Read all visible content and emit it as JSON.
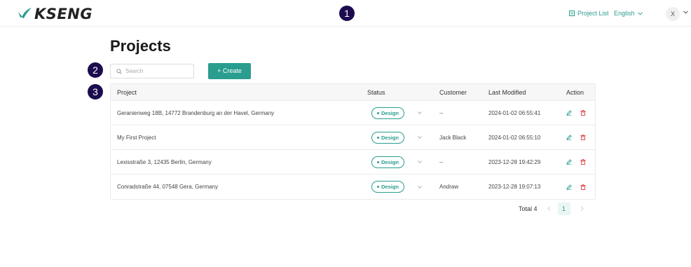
{
  "header": {
    "logo_text": "KSENG",
    "brand_color": "#2a9d8f",
    "logo_icon": "kseng-leaf-logo",
    "nav": {
      "project_list_label": "Project List",
      "project_list_icon": "list-icon"
    },
    "language": {
      "label": "English",
      "icon": "chevron-down-icon"
    },
    "user": {
      "avatar_text": "X",
      "icon": "chevron-down-icon"
    }
  },
  "markers": [
    "1",
    "2",
    "3"
  ],
  "page": {
    "title": "Projects",
    "search": {
      "placeholder": "Search",
      "value": "",
      "icon": "search-icon"
    },
    "create_button": "+ Create"
  },
  "table": {
    "columns": [
      "Project",
      "Status",
      "Customer",
      "Last Modified",
      "Action"
    ],
    "rows": [
      {
        "project": "Geranienweg 18B, 14772 Brandenburg an der Havel, Germany",
        "status": "Design",
        "customer": "--",
        "last_modified": "2024-01-02 06:55:41"
      },
      {
        "project": "My First Project",
        "status": "Design",
        "customer": "Jack Black",
        "last_modified": "2024-01-02 06:55:10"
      },
      {
        "project": "Lexisstraße 3, 12435 Berlin, Germany",
        "status": "Design",
        "customer": "--",
        "last_modified": "2023-12-28 19:42:29"
      },
      {
        "project": "Conradstraße 44, 07548 Gera, Germany",
        "status": "Design",
        "customer": "Andraw",
        "last_modified": "2023-12-28 19:07:13"
      }
    ],
    "action_icons": [
      "edit-icon",
      "delete-icon"
    ],
    "status_color": "#2a9d8f",
    "delete_color": "#e0393e"
  },
  "pagination": {
    "total_label": "Total 4",
    "current_page": "1"
  }
}
